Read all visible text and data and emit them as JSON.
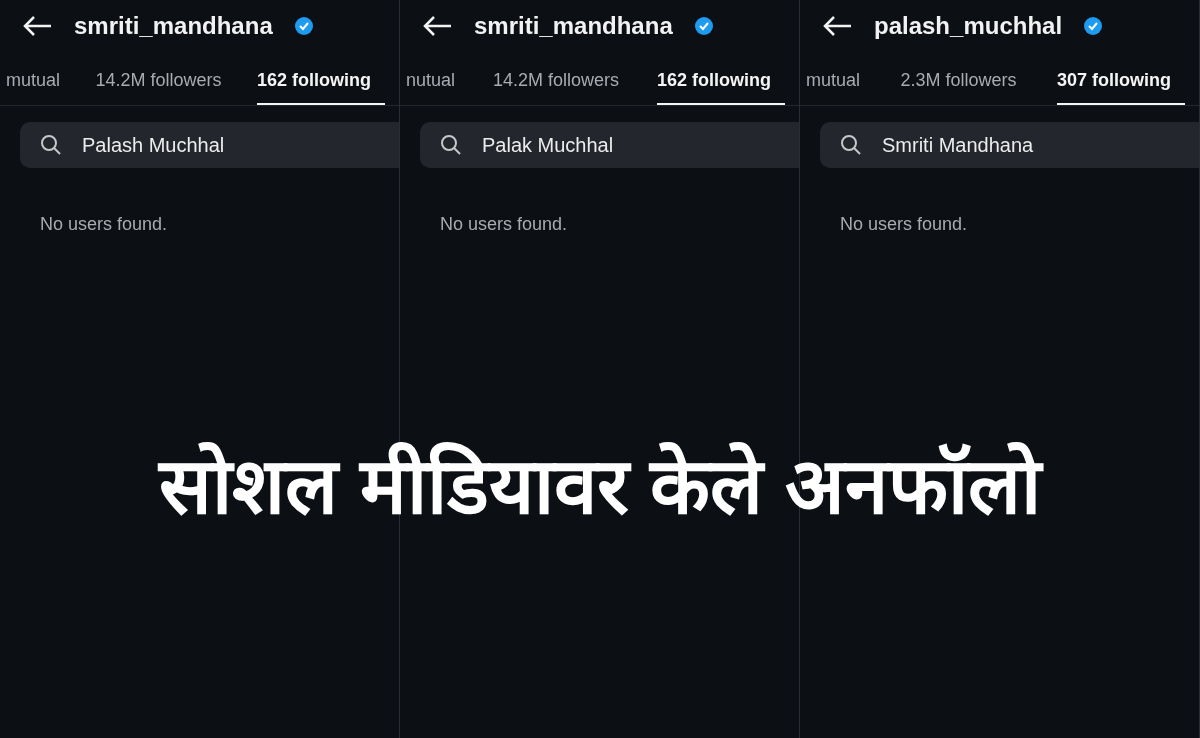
{
  "panels": [
    {
      "username": "smriti_mandhana",
      "verified": true,
      "tabs": [
        {
          "label": "mutual",
          "selected": false
        },
        {
          "label": "14.2M followers",
          "selected": false
        },
        {
          "label": "162 following",
          "selected": true
        }
      ],
      "search": {
        "value": "Palash Muchhal"
      },
      "message": "No users found."
    },
    {
      "username": "smriti_mandhana",
      "verified": true,
      "tabs": [
        {
          "label": "nutual",
          "selected": false
        },
        {
          "label": "14.2M followers",
          "selected": false
        },
        {
          "label": "162 following",
          "selected": true
        }
      ],
      "search": {
        "value": "Palak Muchhal"
      },
      "message": "No users found."
    },
    {
      "username": "palash_muchhal",
      "verified": true,
      "tabs": [
        {
          "label": "mutual",
          "selected": false
        },
        {
          "label": "2.3M followers",
          "selected": false
        },
        {
          "label": "307 following",
          "selected": true
        }
      ],
      "search": {
        "value": "Smriti Mandhana"
      },
      "message": "No users found."
    }
  ],
  "caption": "सोशल मीडियावर केले अनफॉलो"
}
